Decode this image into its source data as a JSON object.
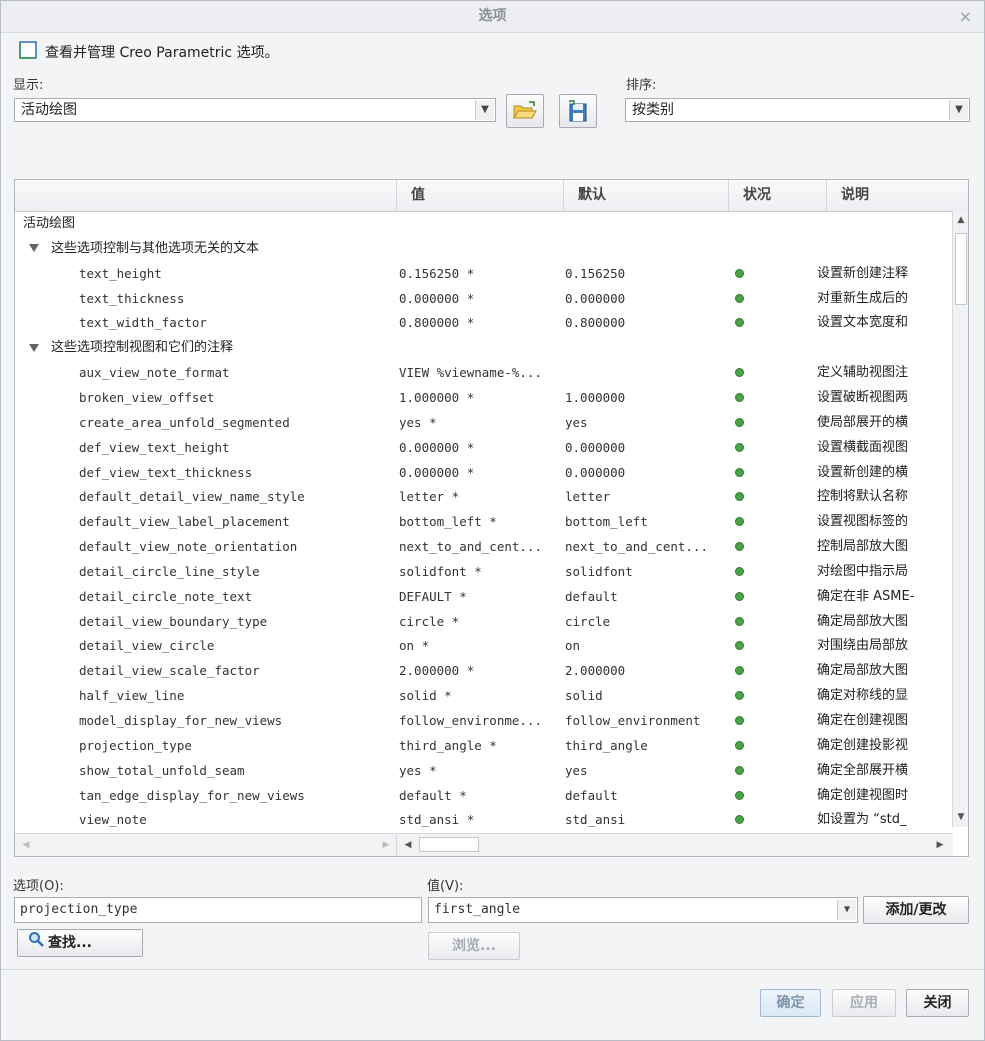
{
  "window": {
    "title": "选项",
    "close_label": "×"
  },
  "intro": {
    "text": "查看并管理 Creo Parametric 选项。"
  },
  "display": {
    "label": "显示:",
    "value": "活动绘图"
  },
  "sort": {
    "label": "排序:",
    "value": "按类别"
  },
  "toolbar": {
    "open_icon": "folder-open-icon",
    "save_icon": "save-icon"
  },
  "table": {
    "columns": [
      "",
      "值",
      "默认",
      "状况",
      "说明"
    ],
    "rows": [
      {
        "type": "root",
        "name": "活动绘图"
      },
      {
        "type": "group",
        "name": "这些选项控制与其他选项无关的文本"
      },
      {
        "type": "option",
        "name": "text_height",
        "value": "0.156250 *",
        "default": "0.156250",
        "status": true,
        "desc": "设置新创建注释"
      },
      {
        "type": "option",
        "name": "text_thickness",
        "value": "0.000000 *",
        "default": "0.000000",
        "status": true,
        "desc": "对重新生成后的"
      },
      {
        "type": "option",
        "name": "text_width_factor",
        "value": "0.800000 *",
        "default": "0.800000",
        "status": true,
        "desc": "设置文本宽度和"
      },
      {
        "type": "group",
        "name": "这些选项控制视图和它们的注释"
      },
      {
        "type": "option",
        "name": "aux_view_note_format",
        "value": "VIEW %viewname-%...",
        "default": "",
        "status": true,
        "desc": "定义辅助视图注"
      },
      {
        "type": "option",
        "name": "broken_view_offset",
        "value": "1.000000 *",
        "default": "1.000000",
        "status": true,
        "desc": "设置破断视图两"
      },
      {
        "type": "option",
        "name": "create_area_unfold_segmented",
        "value": "yes *",
        "default": "yes",
        "status": true,
        "desc": "使局部展开的横"
      },
      {
        "type": "option",
        "name": "def_view_text_height",
        "value": "0.000000 *",
        "default": "0.000000",
        "status": true,
        "desc": "设置横截面视图"
      },
      {
        "type": "option",
        "name": "def_view_text_thickness",
        "value": "0.000000 *",
        "default": "0.000000",
        "status": true,
        "desc": "设置新创建的横"
      },
      {
        "type": "option",
        "name": "default_detail_view_name_style",
        "value": "letter *",
        "default": "letter",
        "status": true,
        "desc": "控制将默认名称"
      },
      {
        "type": "option",
        "name": "default_view_label_placement",
        "value": "bottom_left *",
        "default": "bottom_left",
        "status": true,
        "desc": "设置视图标签的"
      },
      {
        "type": "option",
        "name": "default_view_note_orientation",
        "value": "next_to_and_cent...",
        "default": "next_to_and_cent...",
        "status": true,
        "desc": "控制局部放大图"
      },
      {
        "type": "option",
        "name": "detail_circle_line_style",
        "value": "solidfont *",
        "default": "solidfont",
        "status": true,
        "desc": "对绘图中指示局"
      },
      {
        "type": "option",
        "name": "detail_circle_note_text",
        "value": "DEFAULT *",
        "default": "default",
        "status": true,
        "desc": "确定在非 ASME-"
      },
      {
        "type": "option",
        "name": "detail_view_boundary_type",
        "value": "circle *",
        "default": "circle",
        "status": true,
        "desc": "确定局部放大图"
      },
      {
        "type": "option",
        "name": "detail_view_circle",
        "value": "on *",
        "default": "on",
        "status": true,
        "desc": "对围绕由局部放"
      },
      {
        "type": "option",
        "name": "detail_view_scale_factor",
        "value": "2.000000 *",
        "default": "2.000000",
        "status": true,
        "desc": "确定局部放大图"
      },
      {
        "type": "option",
        "name": "half_view_line",
        "value": "solid *",
        "default": "solid",
        "status": true,
        "desc": "确定对称线的显"
      },
      {
        "type": "option",
        "name": "model_display_for_new_views",
        "value": "follow_environme...",
        "default": "follow_environment",
        "status": true,
        "desc": "确定在创建视图"
      },
      {
        "type": "option",
        "name": "projection_type",
        "value": "third_angle *",
        "default": "third_angle",
        "status": true,
        "desc": "确定创建投影视"
      },
      {
        "type": "option",
        "name": "show_total_unfold_seam",
        "value": "yes *",
        "default": "yes",
        "status": true,
        "desc": "确定全部展开横"
      },
      {
        "type": "option",
        "name": "tan_edge_display_for_new_views",
        "value": "default *",
        "default": "default",
        "status": true,
        "desc": "确定创建视图时"
      },
      {
        "type": "option",
        "name": "view_note",
        "value": "std_ansi *",
        "default": "std_ansi",
        "status": true,
        "desc": "如设置为 “std_"
      }
    ]
  },
  "option_field": {
    "label": "选项(O):",
    "value": "projection_type"
  },
  "value_field": {
    "label": "值(V):",
    "value": "first_angle"
  },
  "buttons": {
    "add_change": "添加/更改",
    "find": "查找...",
    "browse": "浏览...",
    "ok": "确定",
    "apply": "应用",
    "close": "关闭"
  },
  "colors": {
    "status_ok": "#4aa24a",
    "accent_blue": "#2f6fb8"
  }
}
